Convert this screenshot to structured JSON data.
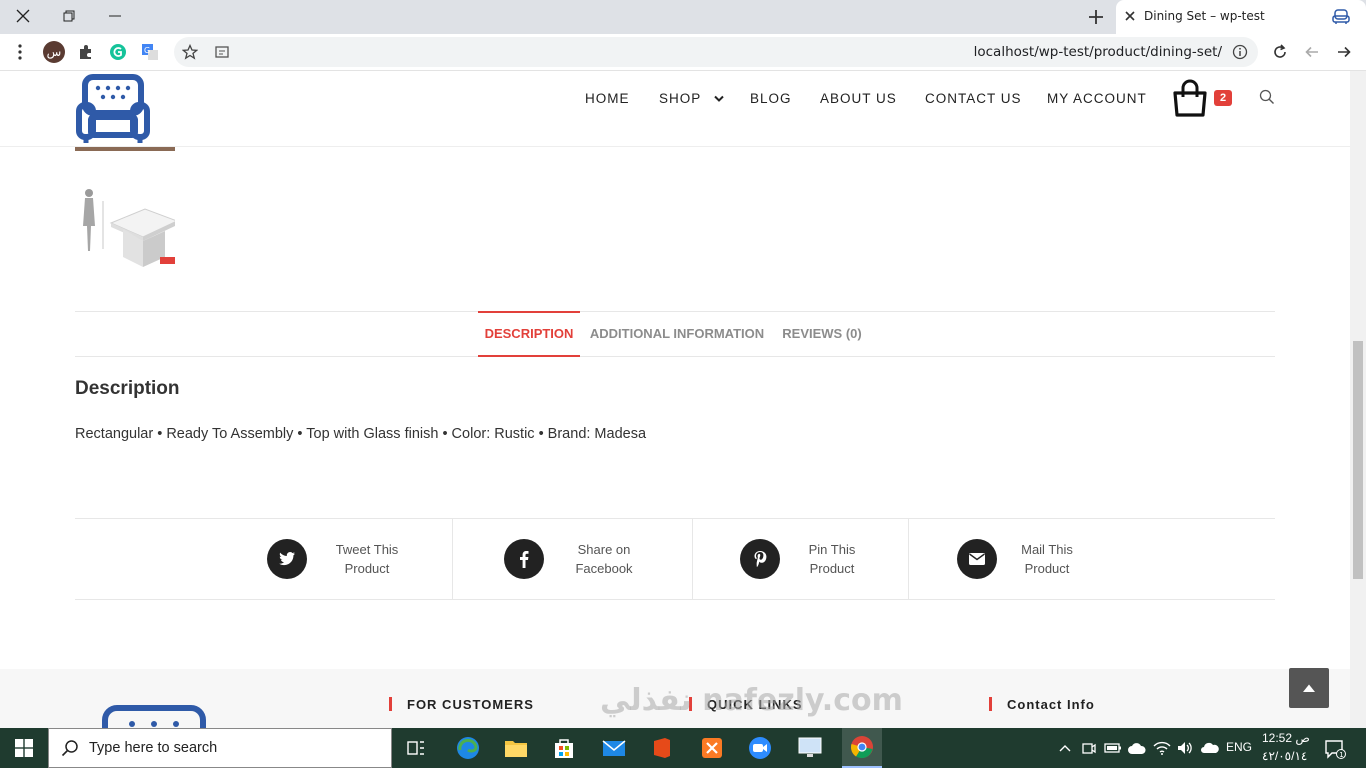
{
  "browser": {
    "tab_title": "Dining Set – wp-test",
    "url": "localhost/wp-test/product/dining-set/",
    "profile_initial": "س"
  },
  "header": {
    "nav": [
      {
        "label": "HOME"
      },
      {
        "label": "SHOP"
      },
      {
        "label": "BLOG"
      },
      {
        "label": "ABOUT US"
      },
      {
        "label": "CONTACT US"
      },
      {
        "label": "MY ACCOUNT"
      }
    ],
    "cart_count": "2"
  },
  "product_tabs": [
    {
      "label": "DESCRIPTION",
      "active": true
    },
    {
      "label": "ADDITIONAL INFORMATION",
      "active": false
    },
    {
      "label": "REVIEWS (0)",
      "active": false
    }
  ],
  "description": {
    "title": "Description",
    "text": "Rectangular • Ready To Assembly • Top with Glass finish • Color: Rustic • Brand: Madesa"
  },
  "share": [
    {
      "line1": "Tweet This",
      "line2": "Product",
      "icon": "twitter-icon"
    },
    {
      "line1": "Share on",
      "line2": "Facebook",
      "icon": "facebook-icon"
    },
    {
      "line1": "Pin This",
      "line2": "Product",
      "icon": "pinterest-icon"
    },
    {
      "line1": "Mail This",
      "line2": "Product",
      "icon": "mail-icon"
    }
  ],
  "footer": {
    "for_customers": "FOR CUSTOMERS",
    "quick_links": "QUICK LINKS",
    "contact_info": "Contact Info"
  },
  "watermark": "نفذلي nafezly.com",
  "taskbar": {
    "search_placeholder": "Type here to search",
    "language": "ENG",
    "time": "12:52 ص",
    "date": "٤٢/٠٥/١٤"
  },
  "colors": {
    "accent": "#e2403a",
    "logo_blue": "#2f5aa8",
    "taskbar": "#1f3b2f"
  }
}
